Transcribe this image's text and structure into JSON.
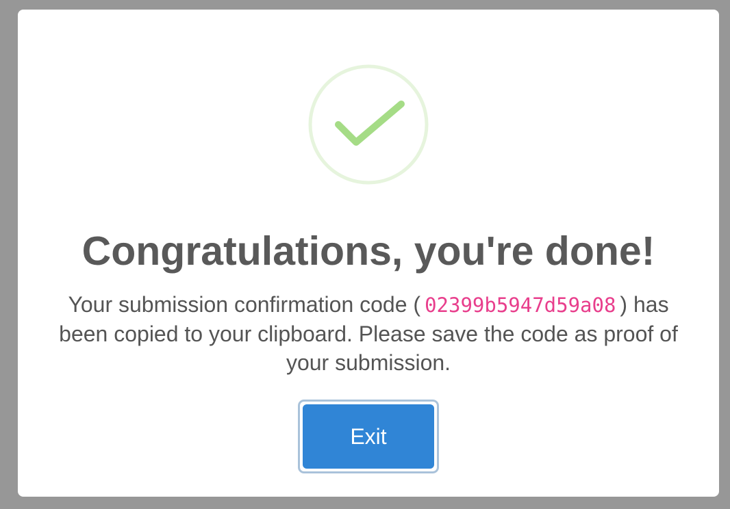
{
  "dialog": {
    "icon": "success-check-icon",
    "title": "Congratulations, you're done!",
    "message_before_code": "Your submission confirmation code (",
    "confirmation_code": "02399b5947d59a08",
    "message_after_code": ") has been copied to your clipboard. Please save the code as proof of your submission.",
    "exit_label": "Exit"
  },
  "colors": {
    "overlay": "#979797",
    "success_ring": "#e6f4dd",
    "success_check": "#a5dc86",
    "title_text": "#595959",
    "code_text": "#e83e8c",
    "button": "#3085d6",
    "button_focus_ring": "#a9c2da"
  }
}
